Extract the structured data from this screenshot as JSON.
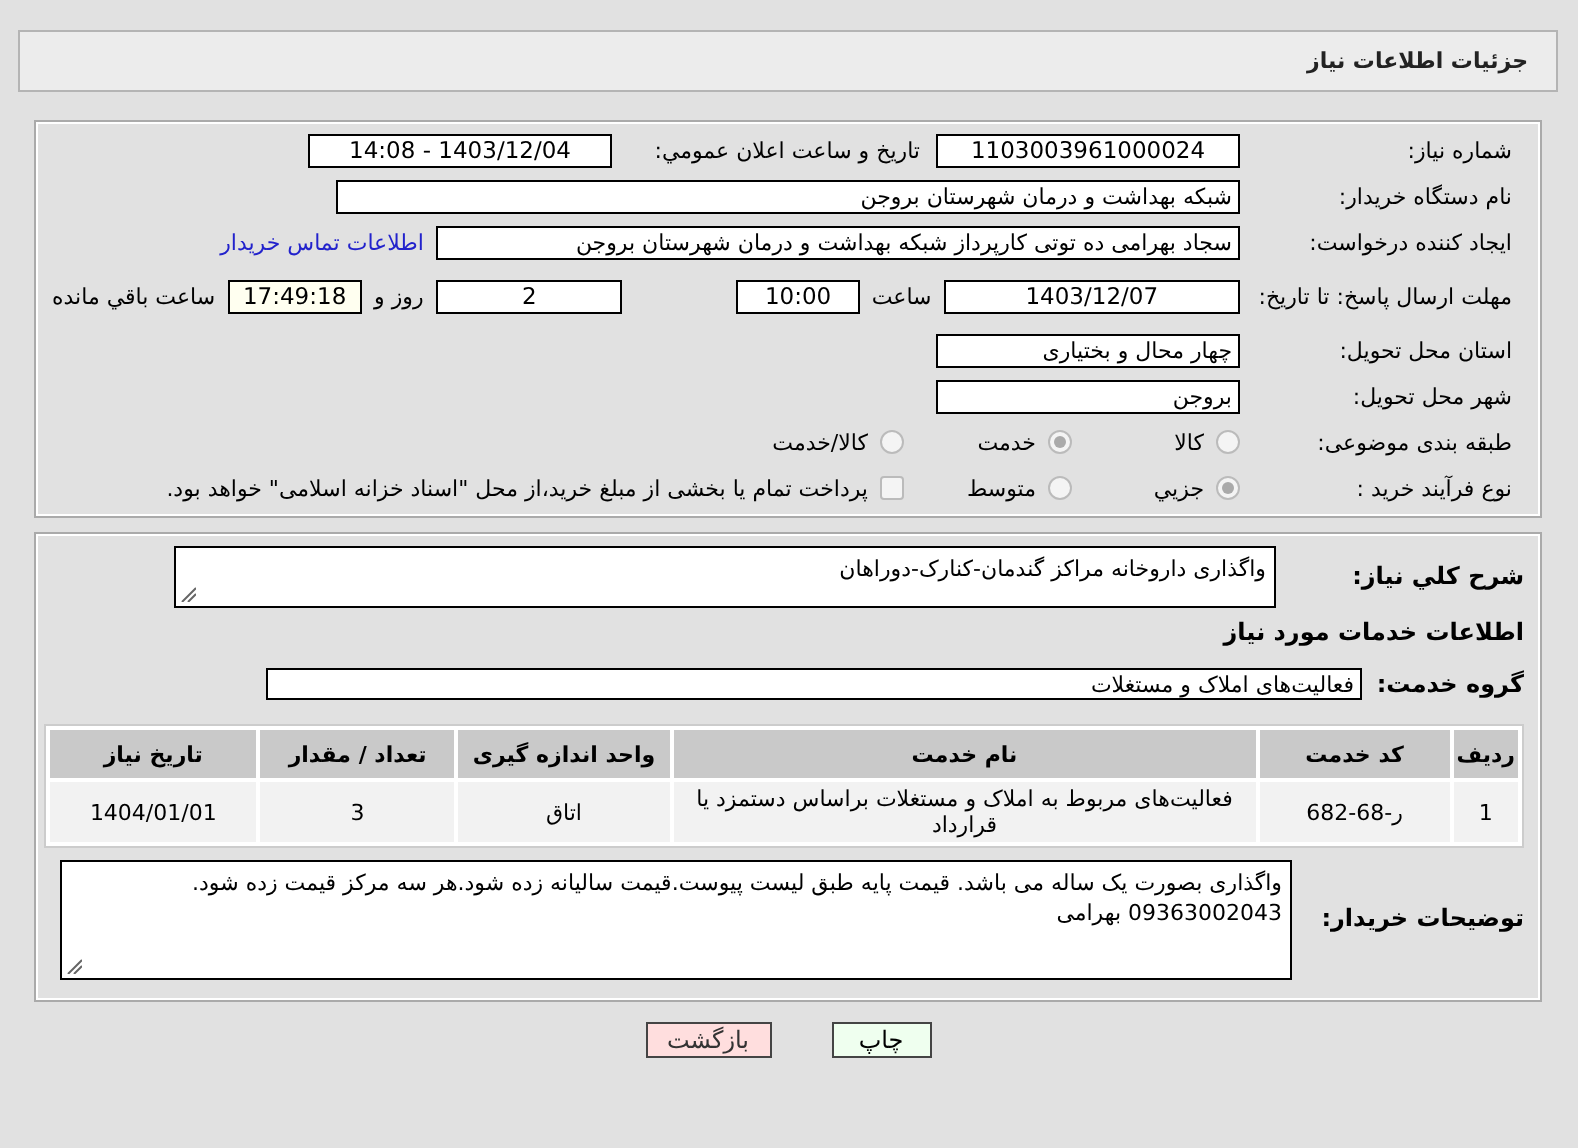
{
  "header": {
    "title": "جزئیات اطلاعات نیاز"
  },
  "need_number": {
    "label": "شماره نیاز:",
    "value": "1103003961000024"
  },
  "announce": {
    "label": "تاریخ و ساعت اعلان عمومي:",
    "value": "1403/12/04 - 14:08"
  },
  "buyer_org": {
    "label": "نام دستگاه خریدار:",
    "value": "شبکه بهداشت و درمان شهرستان بروجن"
  },
  "creator": {
    "label": "ایجاد کننده درخواست:",
    "value": "سجاد بهرامی ده توتی کارپرداز شبکه بهداشت و درمان شهرستان بروجن",
    "link": "اطلاعات تماس خریدار"
  },
  "deadline": {
    "label": "مهلت ارسال پاسخ: تا تاریخ:",
    "date": "1403/12/07",
    "time_label": "ساعت",
    "time": "10:00",
    "days": "2",
    "days_label": "روز و",
    "remaining": "17:49:18",
    "remaining_label": "ساعت باقي مانده"
  },
  "province": {
    "label": "استان محل تحویل:",
    "value": "چهار محال و بختیاری"
  },
  "city": {
    "label": "شهر محل تحویل:",
    "value": "بروجن"
  },
  "classification": {
    "label": "طبقه بندی موضوعی:",
    "options": [
      {
        "label": "کالا",
        "selected": false
      },
      {
        "label": "خدمت",
        "selected": true
      },
      {
        "label": "کالا/خدمت",
        "selected": false
      }
    ]
  },
  "purchase_type": {
    "label": "نوع فرآیند خرید :",
    "options": [
      {
        "label": "جزیي",
        "selected": true
      },
      {
        "label": "متوسط",
        "selected": false
      }
    ],
    "payment": {
      "checked": false,
      "label": "پرداخت تمام یا بخشی از مبلغ خرید،از محل \"اسناد خزانه اسلامی\" خواهد بود."
    }
  },
  "description": {
    "label": "شرح کلي نیاز:",
    "value": "واگذاری داروخانه مراکز گندمان-کنارک-دوراهان"
  },
  "services_heading": "اطلاعات خدمات مورد نیاز",
  "service_group": {
    "label": "گروه خدمت:",
    "value": "فعالیت‌های  املاک و مستغلات"
  },
  "table": {
    "columns": [
      "ردیف",
      "کد خدمت",
      "نام خدمت",
      "واحد اندازه گیری",
      "تعداد / مقدار",
      "تاریخ نیاز"
    ],
    "rows": [
      [
        "1",
        "ر-68-682",
        "فعالیت‌های مربوط به املاک و مستغلات براساس دستمزد یا قرارداد",
        "اتاق",
        "3",
        "1404/01/01"
      ]
    ]
  },
  "buyer_notes": {
    "label": "توضیحات خریدار:",
    "value": "واگذاری بصورت یک ساله می باشد. قیمت پایه طبق لیست پیوست.قیمت سالیانه زده شود.هر سه مرکز قیمت زده شود. 09363002043 بهرامی"
  },
  "buttons": [
    {
      "kind": "print",
      "label": "چاپ"
    },
    {
      "kind": "back",
      "label": "بازگشت"
    }
  ]
}
